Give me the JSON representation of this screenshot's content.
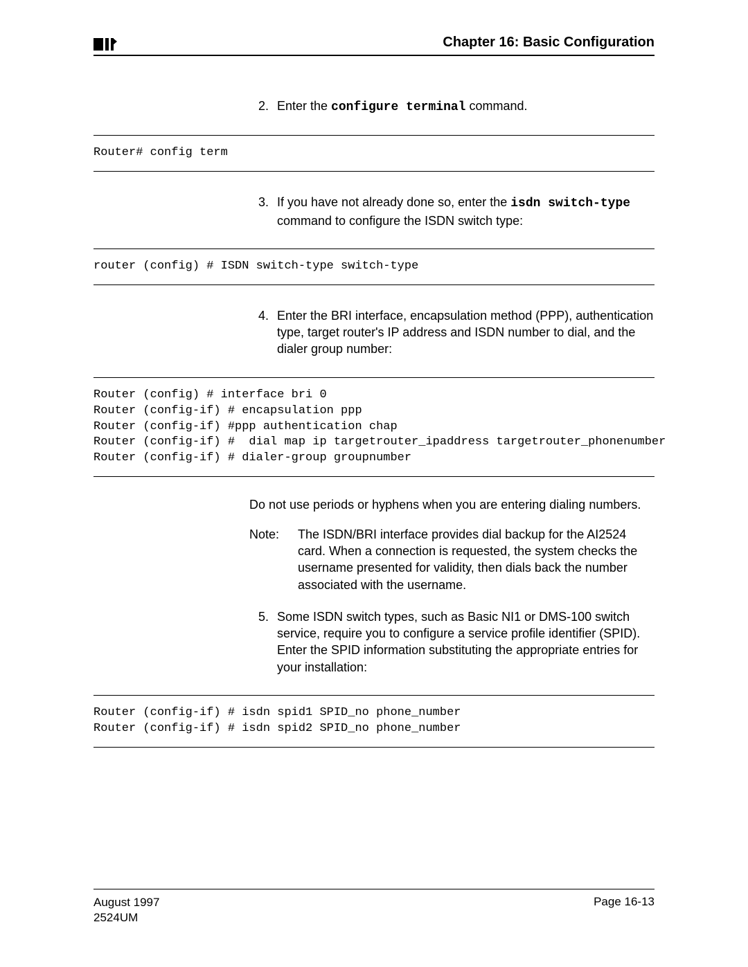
{
  "header": {
    "chapter_title": "Chapter 16: Basic Configuration"
  },
  "steps": {
    "s2": {
      "num": "2.",
      "pre": "Enter the ",
      "cmd": "configure terminal",
      "post": " command."
    },
    "s3": {
      "num": "3.",
      "pre": "If you have not already done so, enter the ",
      "cmd": "isdn switch-type",
      "post": " command to configure the ISDN switch type:"
    },
    "s4": {
      "num": "4.",
      "text": "Enter the BRI interface, encapsulation method (PPP), authentication type, target router's IP address and ISDN number to dial, and the dialer group number:"
    },
    "s5": {
      "num": "5.",
      "text": "Some ISDN switch types, such as Basic NI1 or DMS-100 switch service, require you to configure a service profile identifier (SPID). Enter the SPID information substituting the appropriate entries for your installation:"
    }
  },
  "code": {
    "c2": "Router# config term",
    "c3": "router (config) # ISDN switch-type switch-type",
    "c4": "Router (config) # interface bri 0\nRouter (config-if) # encapsulation ppp\nRouter (config-if) #ppp authentication chap\nRouter (config-if) #  dial map ip targetrouter_ipaddress targetrouter_phonenumber\nRouter (config-if) # dialer-group groupnumber",
    "c5": "Router (config-if) # isdn spid1 SPID_no phone_number\nRouter (config-if) # isdn spid2 SPID_no phone_number"
  },
  "body": {
    "no_periods": "Do not use periods or hyphens when you are entering dialing numbers.",
    "note_label": "Note:",
    "note_body": "The ISDN/BRI interface provides dial backup for the AI2524 card. When a connection is requested, the system checks the username presented for validity, then dials back the number associated with the username."
  },
  "footer": {
    "date": "August 1997",
    "doc": "2524UM",
    "page": "Page 16-13"
  }
}
